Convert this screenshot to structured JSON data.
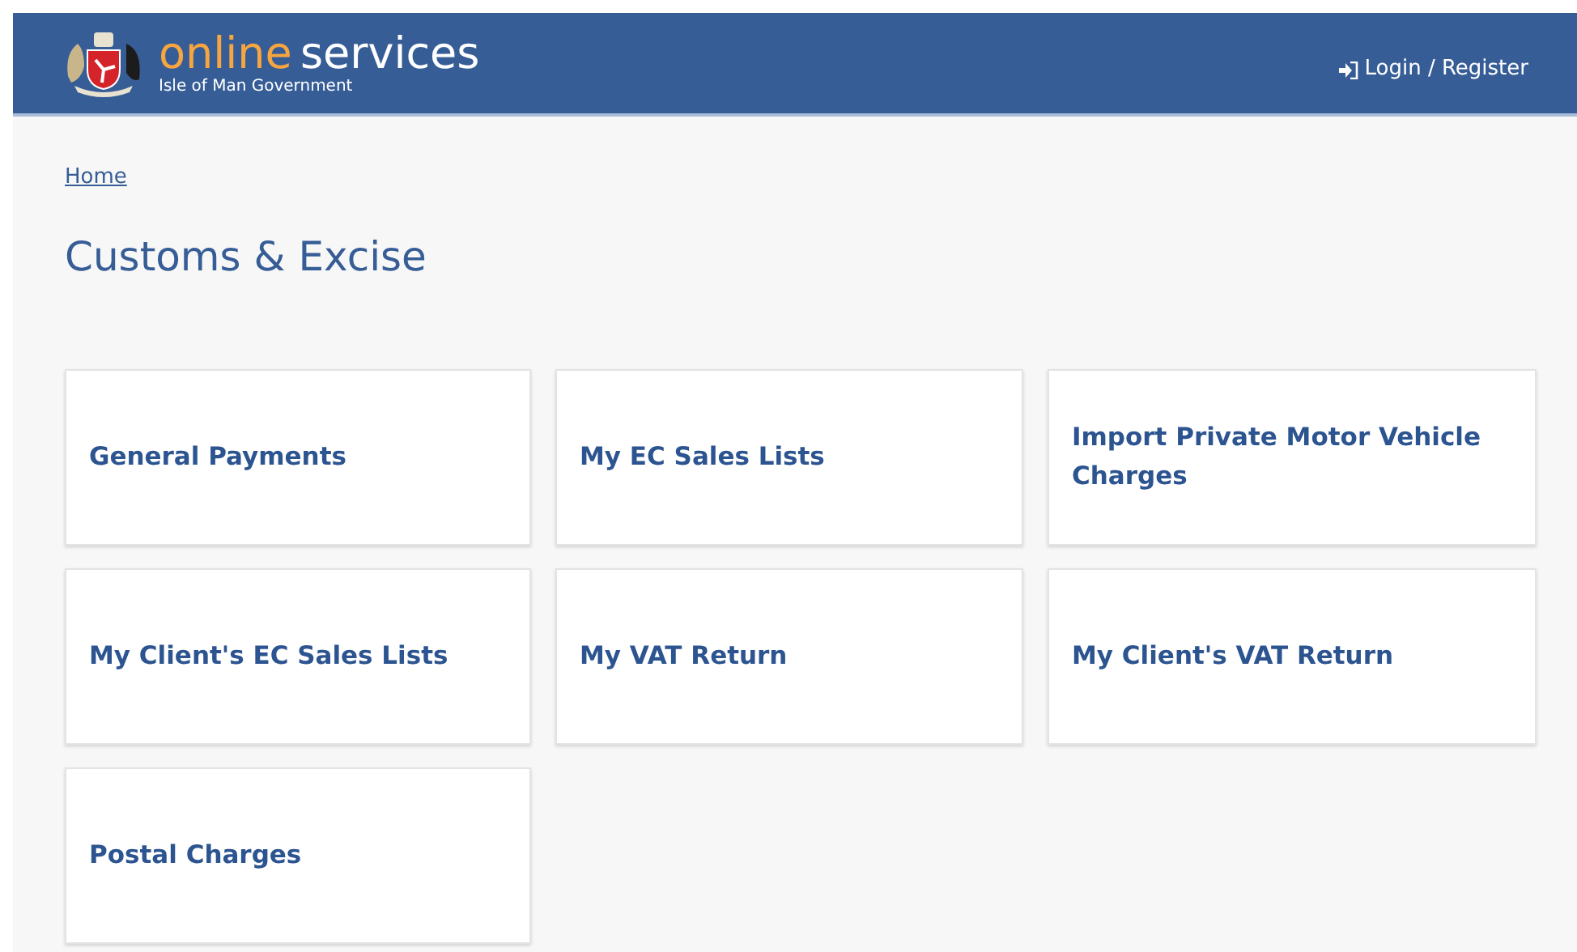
{
  "header": {
    "brand": "online",
    "brand_suffix": "services",
    "subtitle": "Isle of Man Government",
    "login": "Login / Register"
  },
  "breadcrumb": [
    "Home"
  ],
  "title": "Customs & Excise",
  "services": [
    {
      "label": "General Payments"
    },
    {
      "label": "My EC Sales Lists"
    },
    {
      "label": "Import Private Motor Vehicle Charges"
    },
    {
      "label": "My Client's EC Sales Lists"
    },
    {
      "label": "My VAT Return"
    },
    {
      "label": "My Client's VAT Return"
    },
    {
      "label": "Postal Charges"
    }
  ]
}
